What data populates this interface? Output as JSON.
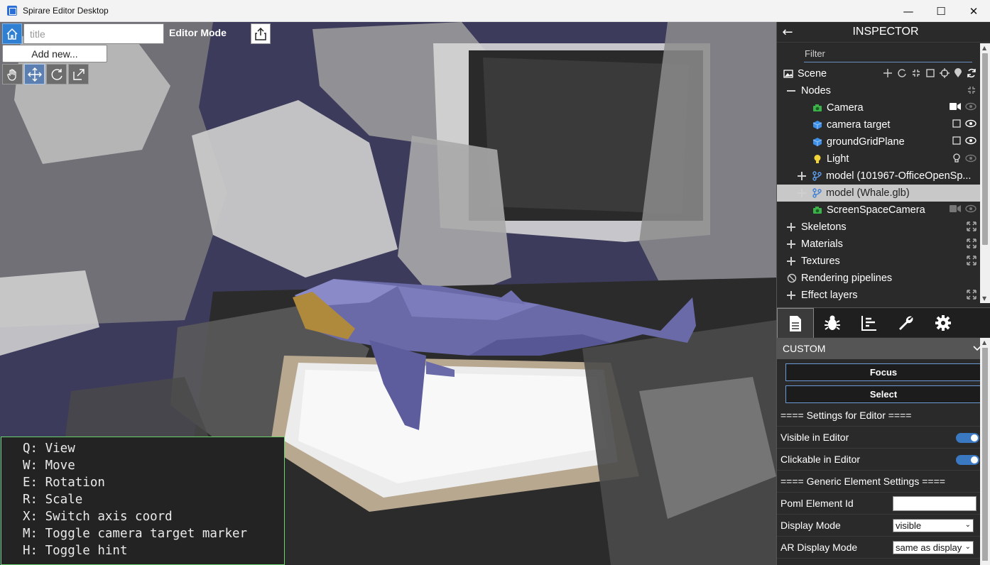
{
  "window": {
    "title": "Spirare Editor Desktop",
    "minimize": "—",
    "maximize": "☐",
    "close": "✕"
  },
  "toolbar": {
    "title_placeholder": "title",
    "mode_label": "Editor Mode",
    "add_new_label": "Add new..."
  },
  "hints": [
    "Q: View",
    "W: Move",
    "E: Rotation",
    "R: Scale",
    "X: Switch axis coord",
    "M: Toggle camera target marker",
    "H: Toggle hint"
  ],
  "inspector": {
    "title": "INSPECTOR",
    "filter_label": "Filter",
    "tree": {
      "scene": "Scene",
      "nodes": "Nodes",
      "items": [
        {
          "label": "Camera",
          "icon": "camera-icon"
        },
        {
          "label": "camera target",
          "icon": "cube-icon"
        },
        {
          "label": "groundGridPlane",
          "icon": "cube-icon"
        },
        {
          "label": "Light",
          "icon": "lightbulb-icon"
        },
        {
          "label": "model (101967-OfficeOpenSp...",
          "icon": "model-icon"
        },
        {
          "label": "model (Whale.glb)",
          "icon": "model-icon"
        },
        {
          "label": "ScreenSpaceCamera",
          "icon": "camera-icon"
        }
      ],
      "sections": [
        "Skeletons",
        "Materials",
        "Textures",
        "Rendering pipelines",
        "Effect layers"
      ]
    },
    "custom": {
      "header": "CUSTOM",
      "focus_label": "Focus",
      "select_label": "Select",
      "editor_settings_header": "==== Settings for Editor ====",
      "visible_in_editor": "Visible in Editor",
      "clickable_in_editor": "Clickable in Editor",
      "generic_header": "==== Generic Element Settings ====",
      "poml_element_id": "Poml Element Id",
      "display_mode": "Display Mode",
      "display_mode_value": "visible",
      "ar_display_mode": "AR Display Mode",
      "ar_display_mode_value": "same as display"
    }
  },
  "colors": {
    "accent": "#2f7fd3",
    "inspector_bg": "#2a2a2a",
    "toggle_on": "#3b78c2",
    "hint_border": "#6bd36b"
  }
}
